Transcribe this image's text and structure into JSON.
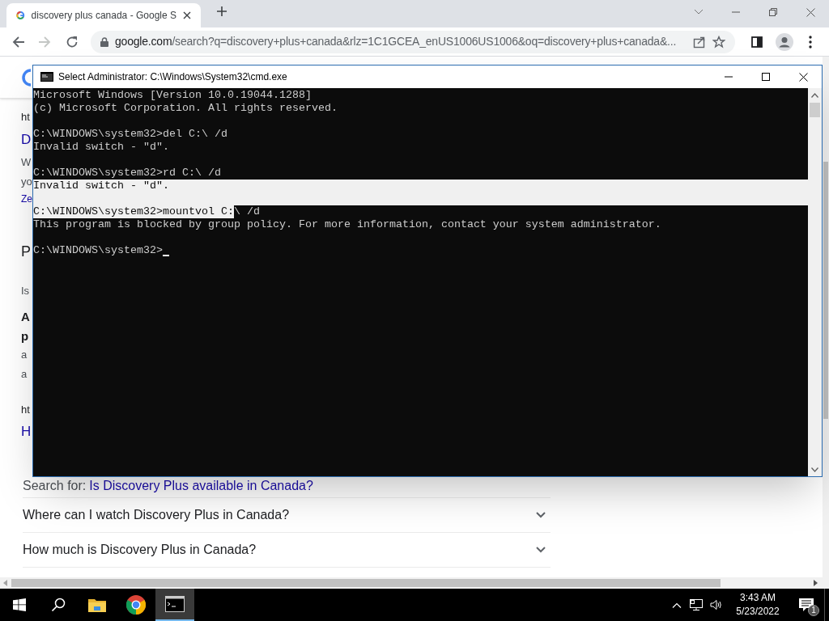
{
  "browser": {
    "tab": {
      "title": "discovery plus canada - Google S",
      "selected": true
    },
    "url": {
      "host": "google.com",
      "rest": "/search?q=discovery+plus+canada&rlz=1C1GCEA_enUS1006US1006&oq=discovery+plus+canada&..."
    },
    "forward_disabled": true,
    "page": {
      "fragments": [
        {
          "text": "ht",
          "kind": "url"
        },
        {
          "text": "D",
          "kind": "title"
        },
        {
          "text": "W",
          "kind": "body"
        },
        {
          "text": "yo",
          "kind": "body"
        },
        {
          "text": "Ze",
          "kind": "link"
        },
        {
          "text": "P",
          "kind": "heading"
        },
        {
          "text": "Is",
          "kind": "body"
        },
        {
          "text": "A",
          "kind": "bold"
        },
        {
          "text": "p",
          "kind": "bold"
        },
        {
          "text": "a",
          "kind": "body"
        },
        {
          "text": "a",
          "kind": "body"
        },
        {
          "text": "ht",
          "kind": "url"
        },
        {
          "text": "H",
          "kind": "title"
        }
      ],
      "search_for": {
        "label": "Search for:",
        "link": "Is Discovery Plus available in Canada?"
      },
      "questions": [
        {
          "text": "Where can I watch Discovery Plus in Canada?",
          "expanded": false
        },
        {
          "text": "How much is Discovery Plus in Canada?",
          "expanded": false
        }
      ]
    }
  },
  "console": {
    "title": "Select Administrator: C:\\Windows\\System32\\cmd.exe",
    "lines": [
      {
        "segments": [
          {
            "text": "Microsoft Windows [Version 10.0.19044.1288]",
            "selected": false
          }
        ]
      },
      {
        "segments": [
          {
            "text": "(c) Microsoft Corporation. All rights reserved.",
            "selected": false
          }
        ]
      },
      {
        "kind": "blank",
        "selected": false
      },
      {
        "segments": [
          {
            "text": "C:\\WINDOWS\\system32>del C:\\ /d",
            "selected": false
          }
        ]
      },
      {
        "segments": [
          {
            "text": "Invalid switch - \"d\".",
            "selected": false
          }
        ]
      },
      {
        "kind": "blank",
        "selected": false
      },
      {
        "segments": [
          {
            "text": "C:\\WINDOWS\\system32>rd C:\\ /d",
            "selected": false
          }
        ]
      },
      {
        "segments": [
          {
            "text": "Invalid switch - \"d\".",
            "selected": true
          }
        ],
        "full_row_selected": true
      },
      {
        "kind": "blank",
        "selected": true
      },
      {
        "segments": [
          {
            "text": "C:\\WINDOWS\\system32>mountvol C:",
            "selected": true
          },
          {
            "text": "\\ /d",
            "selected": false
          }
        ]
      },
      {
        "segments": [
          {
            "text": "This program is blocked by group policy. For more information, contact your system administrator.",
            "selected": false
          }
        ]
      },
      {
        "kind": "blank",
        "selected": false
      },
      {
        "segments": [
          {
            "text": "C:\\WINDOWS\\system32>",
            "selected": false
          }
        ],
        "cursor": true
      }
    ]
  },
  "taskbar": {
    "apps": [
      {
        "kind": "start",
        "selected": false
      },
      {
        "kind": "search",
        "selected": false
      },
      {
        "kind": "explorer",
        "selected": false
      },
      {
        "kind": "chrome",
        "selected": false
      },
      {
        "kind": "console",
        "selected": true
      }
    ],
    "time": "3:43 AM",
    "date": "5/23/2022",
    "notifications": "1"
  }
}
